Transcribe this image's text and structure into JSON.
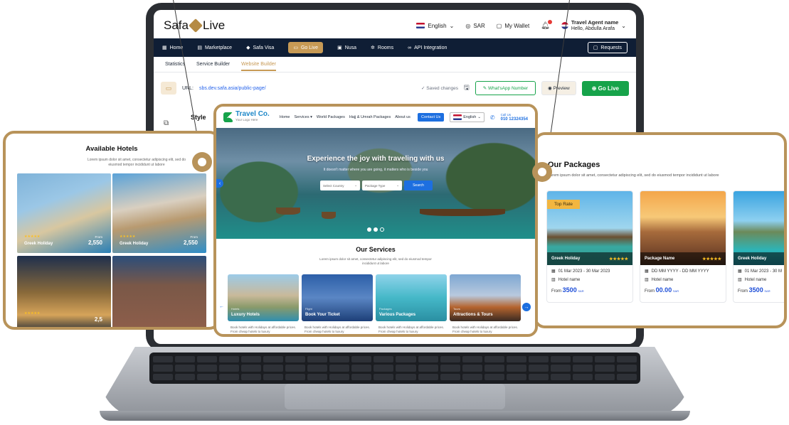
{
  "app": {
    "logo": "Safa",
    "logo2": "Live",
    "language": "English",
    "currency": "SAR",
    "wallet": "My Wallet",
    "agent_name": "Travel Agent name",
    "agent_greeting": "Hello, Abdulla Arafa"
  },
  "nav": {
    "items": [
      "Home",
      "Marketplace",
      "Safa Visa",
      "Go Live",
      "Nusa",
      "Rooms",
      "API Integration"
    ],
    "active": "Go Live",
    "requests": "Requests"
  },
  "subnav": [
    "Statistics",
    "Service Builder",
    "Website Builder"
  ],
  "builder": {
    "url_label": "URL:",
    "url": "sbs.dev.safa.asia/public-page/",
    "saved": "Saved changes",
    "whatsapp": "What'sApp Number",
    "preview": "Preview",
    "go_live": "Go Live",
    "style": "Style"
  },
  "hotels": {
    "title": "Available Hotels",
    "desc": "Lorem ipsum dolor sit amet, consectetur adipiscing elit, sed do eiusmod tempor incididunt ut labore",
    "items": [
      {
        "name": "Greek Holiday",
        "price": "2,550",
        "from": "From",
        "stars": "★★★★★"
      },
      {
        "name": "Greek Holiday",
        "price": "2,550",
        "from": "From",
        "stars": "★★★★★"
      },
      {
        "name": "",
        "price": "2,5",
        "from": "",
        "stars": "★★★★★"
      },
      {
        "name": "",
        "price": "",
        "from": "",
        "stars": ""
      }
    ]
  },
  "site": {
    "logo": "Travel Co.",
    "tagline": "Your Logo Here",
    "links": [
      "Home",
      "Services ▾",
      "World Packages",
      "Hajj & Umrah Packages",
      "About us"
    ],
    "contact": "Contact Us",
    "lang": "English",
    "call_label": "Call Us",
    "phone": "010 12324354",
    "hero_title": "Experience the joy with traveling with us",
    "hero_sub": "It doesn't matter where you are going, it matters who is beside you",
    "select_country": "Select Country",
    "package_type": "Package Type",
    "search": "Search",
    "services_title": "Our Services",
    "services_desc": "Lorem ipsum dolor sit amet, consectetur adipiscing elit, sed do eiusmod tempor incididunt ut labore",
    "services": [
      {
        "cat": "Hotels",
        "name": "Luxury Hotels",
        "body": "Book hotels with Holidays at affordable prices. From cheap hotels to luxury"
      },
      {
        "cat": "Flight",
        "name": "Book Your Ticket",
        "body": "Book hotels with Holidays at affordable prices. From cheap hotels to luxury"
      },
      {
        "cat": "Packages",
        "name": "Various Packages",
        "body": "Book hotels with Holidays at affordable prices. From cheap hotels to luxury"
      },
      {
        "cat": "Tours",
        "name": "Attractions & Tours",
        "body": "Book hotels with Holidays at affordable prices. From cheap hotels to luxury"
      }
    ]
  },
  "packages": {
    "title": "Our Packages",
    "desc": "Lorem ipsum dolor sit amet, consectetur adipiscing elit, sed do eiusmod tempor incididunt ut labore",
    "top_rate": "Top Rate",
    "items": [
      {
        "name": "Greek Holiday",
        "stars": "★★★★★",
        "dates": "01 Mar 2023 - 30 Mar 2023",
        "hotel": "Hotel name",
        "from": "From",
        "price": "3500",
        "cur": "SAR"
      },
      {
        "name": "Package Name",
        "stars": "★★★★★",
        "dates": "DD MM YYYY - DD MM YYYY",
        "hotel": "Hotel name",
        "from": "From",
        "price": "00.00",
        "cur": "SAR"
      },
      {
        "name": "Greek Holiday",
        "stars": "",
        "dates": "01 Mar 2023 - 30 M",
        "hotel": "Hotel name",
        "from": "From",
        "price": "3500",
        "cur": "SAR"
      }
    ]
  }
}
